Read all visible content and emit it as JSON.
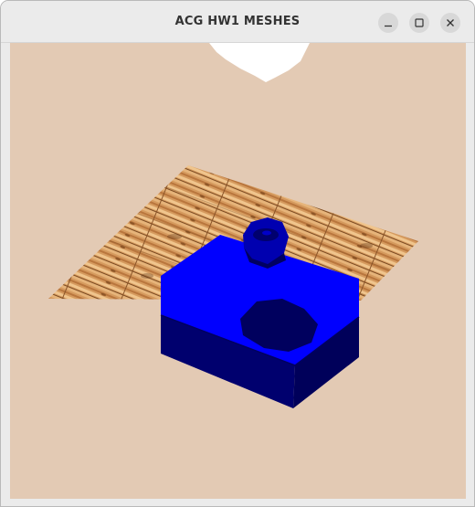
{
  "window": {
    "title": "ACG HW1 MESHES"
  },
  "controls": {
    "minimize": {
      "icon": "minimize-icon"
    },
    "maximize": {
      "icon": "maximize-icon"
    },
    "close": {
      "icon": "close-icon"
    }
  },
  "scene": {
    "background_color": "#e3cab4",
    "floor_texture": "wood-planks",
    "floor_color": "#c98b4f",
    "mesh_top_color": "#0000ff",
    "mesh_side_color": "#00006e",
    "hole_color": "#00005e",
    "light_color": "#ffffff"
  }
}
